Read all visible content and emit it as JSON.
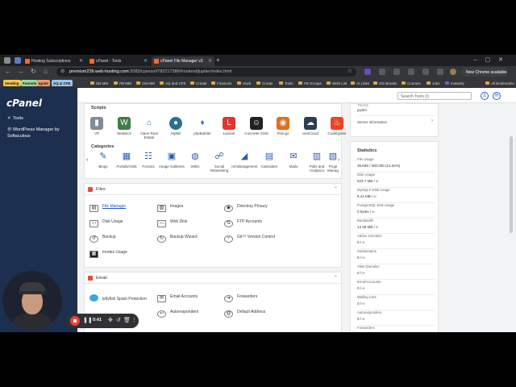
{
  "browser": {
    "tabs": [
      {
        "title": "Hosting Subscriptions",
        "active": false
      },
      {
        "title": "cPanel - Tools",
        "active": false
      },
      {
        "title": "cPanel File Manager v3",
        "active": true
      }
    ],
    "url_host": "premium239.web-hosting.com",
    "url_path": ":2083/cpsess9782217386/frontend/jupiter/index.html",
    "new_chrome_label": "New Chrome available",
    "bookmarks_tags": [
      "Vending",
      "Funnels",
      "Ignite",
      "AQ & CFE"
    ],
    "bookmarks": [
      "DB MM",
      "PB MM",
      "CM MM",
      "AQ and CFE",
      "Create",
      "Finances",
      "Hack",
      "Create",
      "Tools",
      "FB Groups",
      "Wish List",
      "AI Links",
      "OG Breaks",
      "Courses",
      "Jobs",
      "Instantly"
    ],
    "all_bookmarks": "All Bookmarks"
  },
  "cpanel": {
    "logo": "cPanel",
    "sidebar": [
      {
        "label": "Tools",
        "icon": "wrench-icon"
      },
      {
        "label": "WordPress Manager by Softaculous",
        "icon": "wordpress-icon"
      }
    ],
    "search_placeholder": "Search Tools (/)",
    "scripts_title": "Scripts",
    "scripts": [
      {
        "label": "Vtf",
        "color": "#7f8c99",
        "glyph": "▮"
      },
      {
        "label": "WeBaCs",
        "color": "#3e7d45",
        "glyph": "W"
      },
      {
        "label": "Open Real Estate",
        "color": "#2a6fb0",
        "glyph": "⌂"
      },
      {
        "label": "MyBB",
        "color": "#2b6f8f",
        "glyph": "●"
      },
      {
        "label": "phpBuilder",
        "color": "#2a78c8",
        "glyph": "♦"
      },
      {
        "label": "Laravel",
        "color": "#e3342f",
        "glyph": "L"
      },
      {
        "label": "Concrete CMS",
        "color": "#222222",
        "glyph": "☺"
      },
      {
        "label": "Pimcgo",
        "color": "#e26e1e",
        "glyph": "◉"
      },
      {
        "label": "ownCloud",
        "color": "#2a3e55",
        "glyph": "☁"
      },
      {
        "label": "CodeIgniter",
        "color": "#ee4323",
        "glyph": "♨"
      }
    ],
    "categories_title": "Categories",
    "categories": [
      {
        "label": "Blogs",
        "glyph": "✎"
      },
      {
        "label": "Portals/CMS",
        "glyph": "▦"
      },
      {
        "label": "Forums",
        "glyph": "☷"
      },
      {
        "label": "Image Galleries",
        "glyph": "▣"
      },
      {
        "label": "Wikis",
        "glyph": "◍"
      },
      {
        "label": "Social Networking",
        "glyph": "☍"
      },
      {
        "label": "Ad Management",
        "glyph": "◢"
      },
      {
        "label": "Calendars",
        "glyph": "▤"
      },
      {
        "label": "Mails",
        "glyph": "✉"
      },
      {
        "label": "Polls and Analytics",
        "glyph": "▥"
      },
      {
        "label": "Proje Manag",
        "glyph": "▧"
      }
    ],
    "files": {
      "title": "Files",
      "tools": [
        {
          "label": "File Manager",
          "highlight": true
        },
        {
          "label": "Images",
          "highlight": false
        },
        {
          "label": "Directory Privacy",
          "highlight": false
        },
        {
          "label": "Disk Usage",
          "highlight": false
        },
        {
          "label": "Web Disk",
          "highlight": false
        },
        {
          "label": "FTP Accounts",
          "highlight": false
        },
        {
          "label": "Backup",
          "highlight": false
        },
        {
          "label": "Backup Wizard",
          "highlight": false
        },
        {
          "label": "Git™ Version Control",
          "highlight": false
        },
        {
          "label": "Inodes Usage",
          "highlight": false
        }
      ]
    },
    "email": {
      "title": "Email",
      "tools": [
        {
          "label": "jellyfish Spam Protection"
        },
        {
          "label": "Email Accounts"
        },
        {
          "label": "Forwarders"
        },
        {
          "label": "Autoresponders"
        },
        {
          "label": "Default Address"
        }
      ]
    },
    "general": {
      "theme_label": "Theme",
      "theme_value": "jupiter",
      "server_info": "Server Information"
    },
    "statistics": {
      "title": "Statistics",
      "items": [
        {
          "label": "File Usage",
          "value": "39,938 / 300,000 (13.32%)"
        },
        {
          "label": "Disk Usage",
          "value": "524.7 MB / ∞"
        },
        {
          "label": "MySQL® Disk Usage",
          "value": "5.44 MB / ∞"
        },
        {
          "label": "PostgreSQL Disk Usage",
          "value": "0 bytes / ∞"
        },
        {
          "label": "Bandwidth",
          "value": "14.38 MB / ∞"
        },
        {
          "label": "Addon Domains",
          "value": "0 / ∞"
        },
        {
          "label": "Subdomains",
          "value": "0 / ∞"
        },
        {
          "label": "Alias Domains",
          "value": "0 / ∞"
        },
        {
          "label": "Email Accounts",
          "value": "0 / ∞"
        },
        {
          "label": "Mailing Lists",
          "value": "0 / ∞"
        },
        {
          "label": "Autoresponders",
          "value": "0 / ∞"
        },
        {
          "label": "Forwarders",
          "value": ""
        }
      ]
    }
  },
  "recorder": {
    "time": "0:41"
  }
}
